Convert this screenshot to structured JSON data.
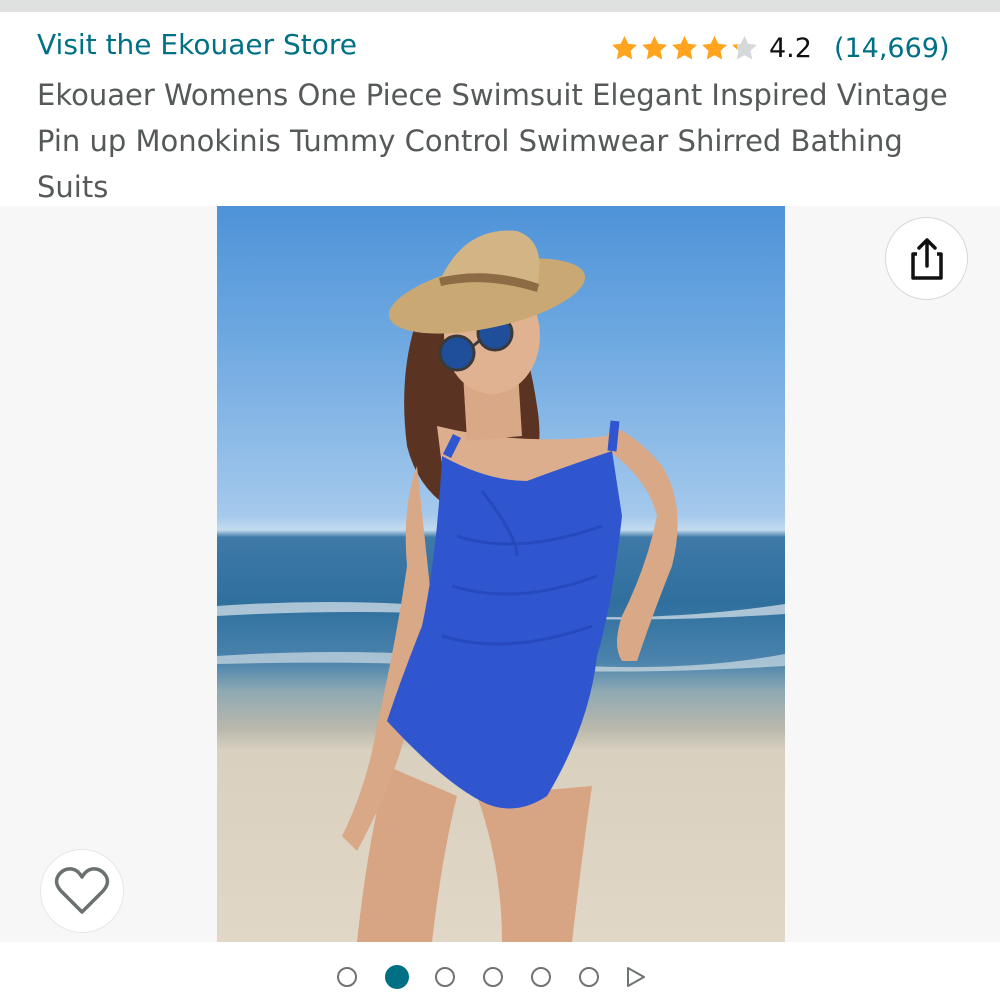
{
  "store": {
    "link_label": "Visit the Ekouaer Store"
  },
  "rating": {
    "value": "4.2",
    "count": "(14,669)",
    "stars_fraction": 0.84,
    "star_color": "#ffa41c",
    "empty_star_color": "#d5d9d9"
  },
  "product": {
    "title": "Ekouaer Womens One Piece Swimsuit Elegant Inspired Vintage Pin up Monokinis Tummy Control Swimwear Shirred Bathing Suits"
  },
  "gallery": {
    "image_count": 6,
    "active_index": 1,
    "share_icon": "share-icon",
    "wishlist_icon": "heart-outline-icon",
    "next_icon": "play-next-icon"
  },
  "colors": {
    "link": "#007185",
    "title_text": "#565959",
    "swimsuit": "#2f55cf"
  }
}
